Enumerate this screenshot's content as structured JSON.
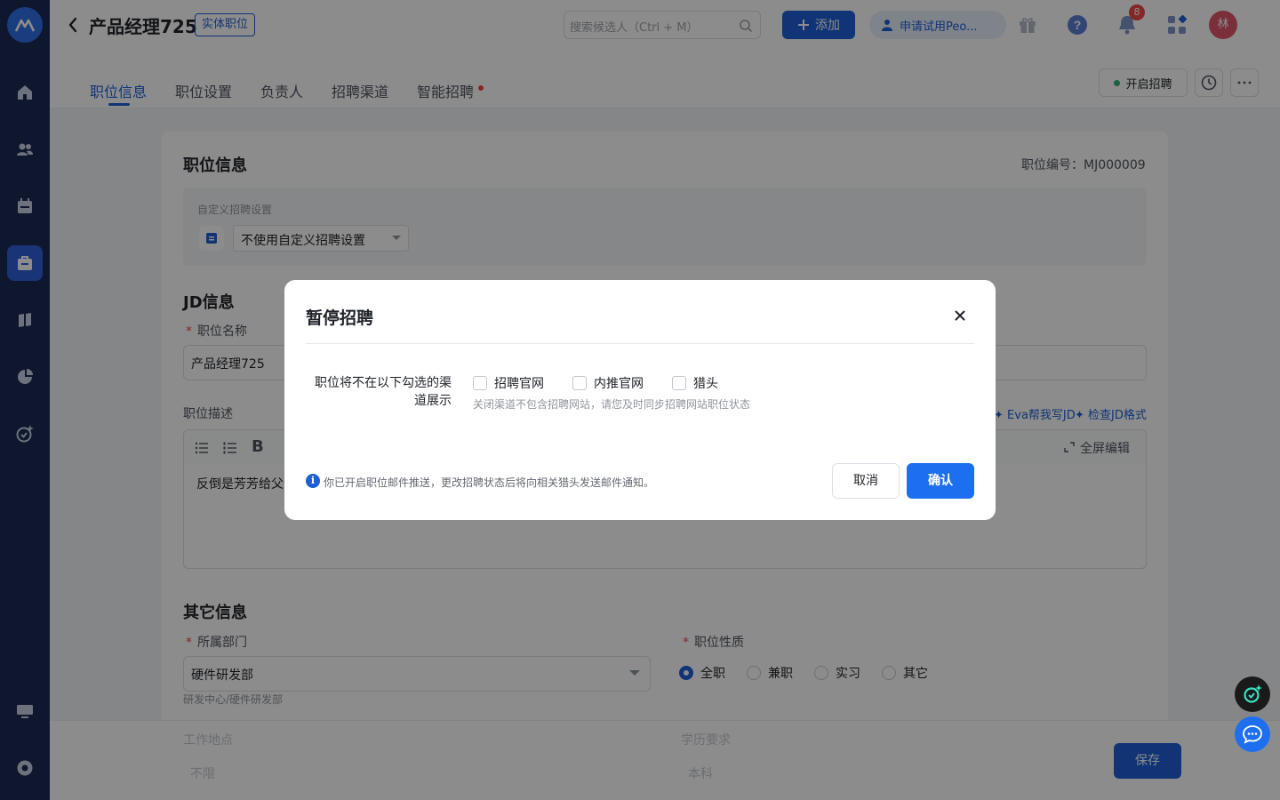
{
  "header": {
    "title": "产品经理725",
    "tag": "实体职位",
    "search_placeholder": "搜索候选人（Ctrl + M）",
    "add_label": "添加",
    "trial_label": "申请试用Peo...",
    "notification_count": "8",
    "avatar_text": "林"
  },
  "tabs": [
    "职位信息",
    "职位设置",
    "负责人",
    "招聘渠道",
    "智能招聘"
  ],
  "actions": {
    "open_recruit": "开启招聘"
  },
  "card": {
    "section_title": "职位信息",
    "position_no": "职位编号：MJ000009",
    "custom_label": "自定义招聘设置",
    "custom_value": "不使用自定义招聘设置",
    "jd_title": "JD信息",
    "name_label": "职位名称",
    "name_value": "产品经理725",
    "desc_label": "职位描述",
    "eva_link": "Eva帮我写JD",
    "check_link": "检查JD格式",
    "fullscreen": "全屏编辑",
    "desc_text": "反倒是芳芳给父母",
    "other_title": "其它信息",
    "dept_label": "所属部门",
    "dept_value": "硬件研发部",
    "dept_path": "研发中心/硬件研发部",
    "nature_label": "职位性质",
    "nature_options": [
      "全职",
      "兼职",
      "实习",
      "其它"
    ],
    "location_label": "工作地点",
    "location_value": "不限",
    "edu_label": "学历要求",
    "edu_value": "本科",
    "save_label": "保存"
  },
  "modal": {
    "title": "暂停招聘",
    "field_label": "职位将不在以下勾选的渠道展示",
    "options": [
      "招聘官网",
      "内推官网",
      "猎头"
    ],
    "hint": "关闭渠道不包含招聘网站，请您及时同步招聘网站职位状态",
    "note": "你已开启职位邮件推送，更改招聘状态后将向相关猎头发送邮件通知。",
    "cancel_label": "取消",
    "confirm_label": "确认"
  },
  "colors": {
    "primary": "#1e5fd6",
    "sidebar": "#1a2b55",
    "danger": "#f04848"
  }
}
